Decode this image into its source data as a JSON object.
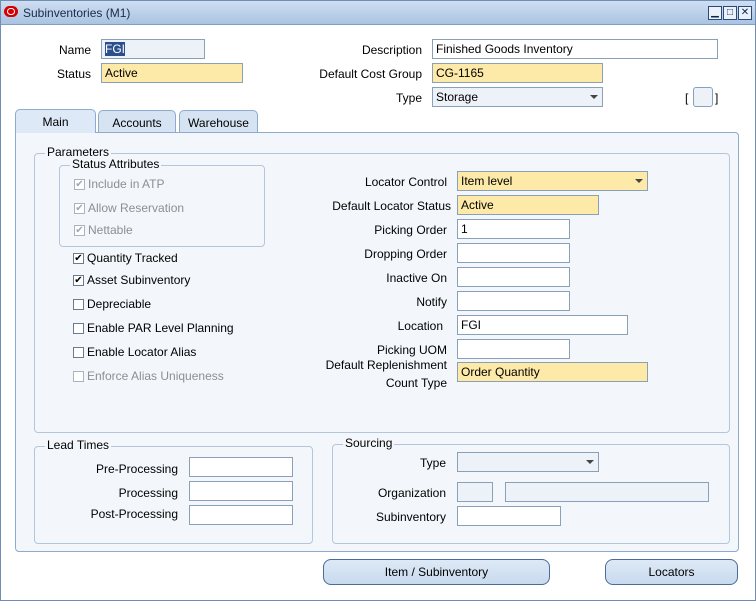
{
  "window": {
    "title": "Subinventories (M1)",
    "minimize": "▁",
    "maximize": "□",
    "close": "✕"
  },
  "header": {
    "name_label": "Name",
    "name_value": "FGI",
    "status_label": "Status",
    "status_value": "Active",
    "description_label": "Description",
    "description_value": "Finished Goods Inventory",
    "cost_group_label": "Default Cost Group",
    "cost_group_value": "CG-1165",
    "type_label": "Type",
    "type_value": "Storage",
    "bracket_left": "[",
    "bracket_right": "]"
  },
  "tabs": [
    {
      "label": "Main",
      "active": true
    },
    {
      "label": "Accounts",
      "active": false
    },
    {
      "label": "Warehouse",
      "active": false
    }
  ],
  "parameters": {
    "title": "Parameters",
    "status_attributes": {
      "title": "Status Attributes",
      "items": [
        {
          "label": "Include in ATP",
          "checked": true
        },
        {
          "label": "Allow Reservation",
          "checked": true
        },
        {
          "label": "Nettable",
          "checked": true
        }
      ]
    },
    "checkboxes": [
      {
        "label": "Quantity Tracked",
        "checked": true
      },
      {
        "label": "Asset Subinventory",
        "checked": true
      },
      {
        "label": "Depreciable",
        "checked": false
      },
      {
        "label": "Enable PAR Level Planning",
        "checked": false
      },
      {
        "label": "Enable Locator Alias",
        "checked": false
      },
      {
        "label": "Enforce Alias Uniqueness",
        "checked": false
      }
    ],
    "locator_control_label": "Locator Control",
    "locator_control_value": "Item level",
    "default_locator_status_label": "Default Locator Status",
    "default_locator_status_value": "Active",
    "picking_order_label": "Picking Order",
    "picking_order_value": "1",
    "dropping_order_label": "Dropping Order",
    "dropping_order_value": "",
    "inactive_on_label": "Inactive On",
    "inactive_on_value": "",
    "notify_label": "Notify",
    "notify_value": "",
    "location_label": "Location",
    "location_value": "FGI",
    "picking_uom_label": "Picking UOM",
    "picking_uom_value": "",
    "replenishment_label_1": "Default Replenishment",
    "replenishment_label_2": "Count Type",
    "replenishment_value": "Order Quantity"
  },
  "lead_times": {
    "title": "Lead Times",
    "pre_processing_label": "Pre-Processing",
    "processing_label": "Processing",
    "post_processing_label": "Post-Processing"
  },
  "sourcing": {
    "title": "Sourcing",
    "type_label": "Type",
    "organization_label": "Organization",
    "subinventory_label": "Subinventory"
  },
  "buttons": {
    "item_subinventory": "Item / Subinventory",
    "locators": "Locators"
  },
  "colors": {
    "required_field": "#fdeaa8",
    "panel_background": "#f3f7fc",
    "title_bar": "#a9c3e2"
  }
}
